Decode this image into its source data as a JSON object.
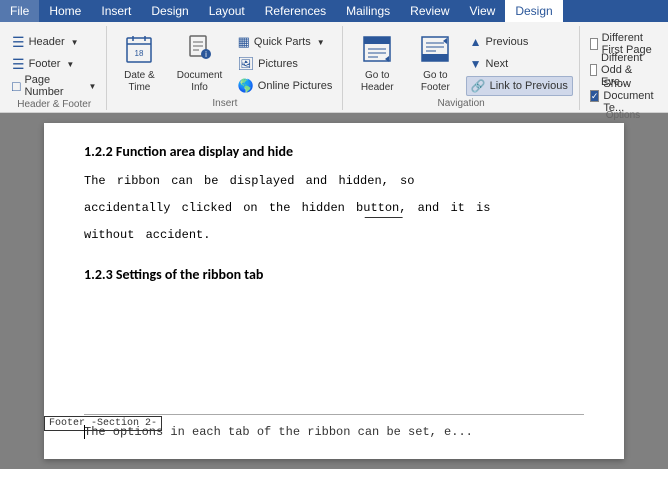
{
  "menubar": {
    "items": [
      {
        "label": "File",
        "active": false
      },
      {
        "label": "Home",
        "active": false
      },
      {
        "label": "Insert",
        "active": false
      },
      {
        "label": "Design",
        "active": false
      },
      {
        "label": "Layout",
        "active": false
      },
      {
        "label": "References",
        "active": false
      },
      {
        "label": "Mailings",
        "active": false
      },
      {
        "label": "Review",
        "active": false
      },
      {
        "label": "View",
        "active": false
      },
      {
        "label": "Design",
        "active": true
      }
    ]
  },
  "ribbon": {
    "groups": {
      "header_footer": {
        "label": "Header & Footer",
        "header_btn": "Header",
        "footer_btn": "Footer",
        "page_num_btn": "Page Number"
      },
      "insert": {
        "label": "Insert",
        "date_time": "Date & Time",
        "doc_info": "Document Info",
        "quick_parts": "Quick Parts",
        "pictures": "Pictures",
        "online_pictures": "Online Pictures"
      },
      "navigation": {
        "label": "Navigation",
        "goto_header": "Go to Header",
        "goto_footer": "Go to Footer",
        "previous": "Previous",
        "next": "Next",
        "link_to_previous": "Link to Previous"
      },
      "options": {
        "label": "Options",
        "different_first_page": "Different First Page",
        "different_odd_even": "Different Odd & Eve...",
        "show_document_text": "Show Document Te..."
      }
    }
  },
  "document": {
    "heading1": "1.2.2 Function area display and hide",
    "para1": "The ribbon can be displayed and hidden, so",
    "para2": "accidentally clicked on the hidden button, and it is",
    "para3": "without accident.",
    "heading2": "1.2.3 Settings of the ribbon tab",
    "footer_text": "The options in each tab of the ribbon can be set, e...",
    "footer_label": "Footer -Section 2-"
  },
  "colors": {
    "brand_blue": "#2b579a",
    "ribbon_bg": "#f3f3f3",
    "doc_bg": "#808080"
  }
}
